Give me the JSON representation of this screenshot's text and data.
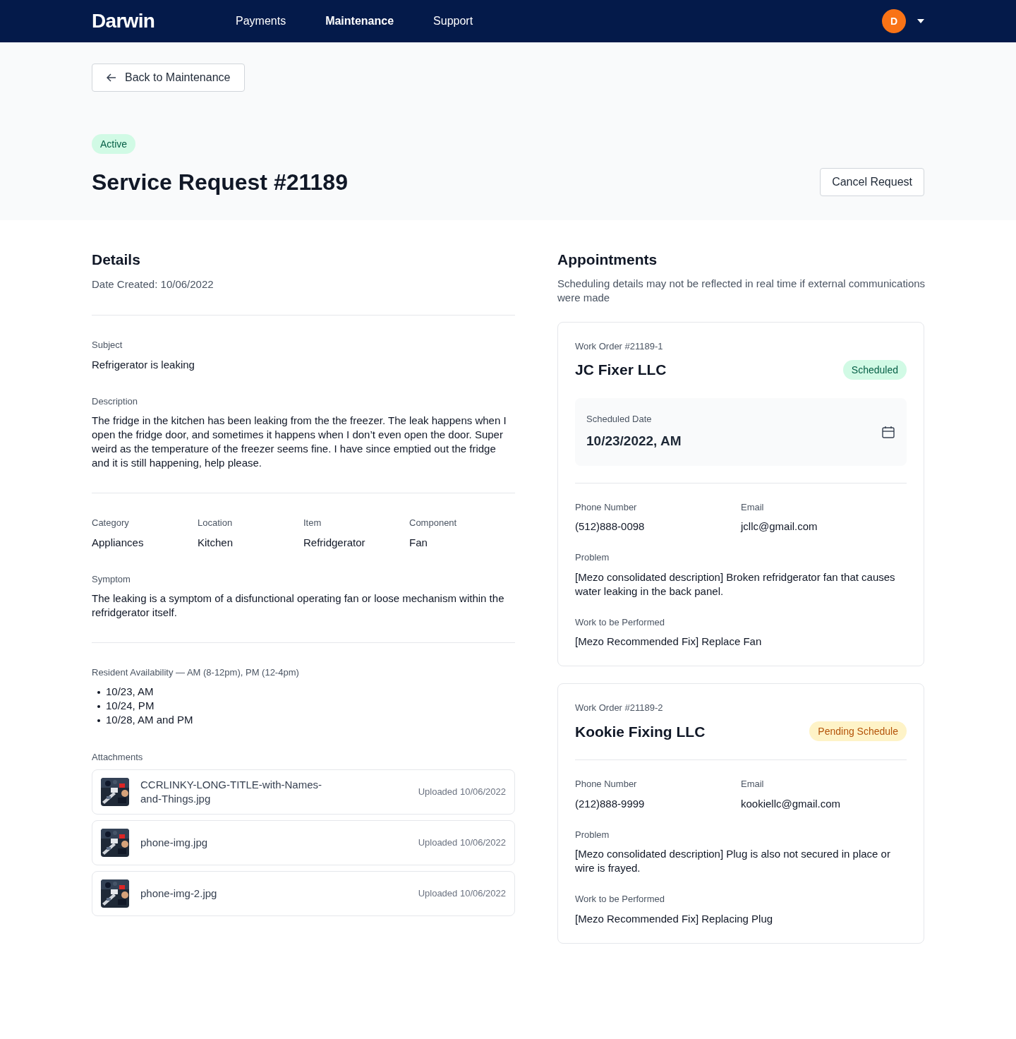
{
  "header": {
    "logo": "Darwin",
    "nav": [
      {
        "label": "Payments",
        "selected": false
      },
      {
        "label": "Maintenance",
        "selected": true
      },
      {
        "label": "Support",
        "selected": false
      }
    ],
    "avatar": "D"
  },
  "back_button": "Back to Maintenance",
  "status": {
    "label": "Active",
    "kind": "success"
  },
  "title": "Service Request #21189",
  "cancel_button": "Cancel Request",
  "details": {
    "heading": "Details",
    "date_created": "Date Created: 10/06/2022",
    "subject": {
      "label": "Subject",
      "value": "Refrigerator is leaking"
    },
    "description": {
      "label": "Description",
      "value": "The fridge in the kitchen has been leaking from the the freezer. The leak happens when I open the fridge door, and sometimes it happens when I don’t even open the door. Super weird as the temperature of the freezer seems fine. I have since emptied out the fridge and it is still happening, help please."
    },
    "fields": [
      {
        "label": "Category",
        "value": "Appliances"
      },
      {
        "label": "Location",
        "value": "Kitchen"
      },
      {
        "label": "Item",
        "value": "Refridgerator"
      },
      {
        "label": "Component",
        "value": "Fan"
      }
    ],
    "symptom": {
      "label": "Symptom",
      "value": "The leaking is a symptom of a disfunctional operating fan or loose mechanism within the refridgerator itself."
    },
    "availability": {
      "label": "Resident Availability — AM (8-12pm), PM (12-4pm)",
      "items": [
        "10/23, AM",
        "10/24, PM",
        "10/28, AM and PM"
      ]
    },
    "attachments": {
      "label": "Attachments",
      "items": [
        {
          "name": "CCRLINKY-LONG-TITLE-with-Names-and-Things.jpg",
          "uploaded": "Uploaded 10/06/2022"
        },
        {
          "name": "phone-img.jpg",
          "uploaded": "Uploaded 10/06/2022"
        },
        {
          "name": "phone-img-2.jpg",
          "uploaded": "Uploaded 10/06/2022"
        }
      ]
    }
  },
  "appointments": {
    "heading": "Appointments",
    "note": "Scheduling details may not be reflected in real time if external communications were made",
    "work_orders": [
      {
        "number": "Work Order #21189-1",
        "vendor": "JC Fixer LLC",
        "status": {
          "label": "Scheduled",
          "kind": "success"
        },
        "scheduled": {
          "label": "Scheduled Date",
          "value": "10/23/2022, AM"
        },
        "phone": {
          "label": "Phone Number",
          "value": "(512)888-0098"
        },
        "email": {
          "label": "Email",
          "value": "jcllc@gmail.com"
        },
        "problem": {
          "label": "Problem",
          "value": "[Mezo consolidated description] Broken refridgerator fan that causes water leaking in the back panel."
        },
        "work": {
          "label": "Work to be Performed",
          "value": "[Mezo Recommended Fix] Replace Fan"
        }
      },
      {
        "number": "Work Order #21189-2",
        "vendor": "Kookie Fixing LLC",
        "status": {
          "label": "Pending Schedule",
          "kind": "warning"
        },
        "phone": {
          "label": "Phone Number",
          "value": "(212)888-9999"
        },
        "email": {
          "label": "Email",
          "value": "kookiellc@gmail.com"
        },
        "problem": {
          "label": "Problem",
          "value": "[Mezo consolidated description] Plug is also not secured in place or wire is frayed."
        },
        "work": {
          "label": "Work to be Performed",
          "value": "[Mezo Recommended Fix] Replacing Plug"
        }
      }
    ]
  }
}
